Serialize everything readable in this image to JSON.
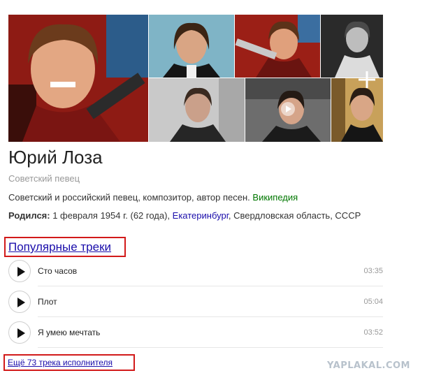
{
  "entity": {
    "name": "Юрий Лоза",
    "subtitle": "Советский певец",
    "description": "Советский и российский певец, композитор, автор песен.",
    "wiki_link": "Википедия",
    "born_label": "Родился:",
    "born_text": " 1 февраля 1954 г. (62 года), ",
    "born_city": "Екатеринбург",
    "born_rest": ", Свердловская область, СССР"
  },
  "gallery": {
    "photos": [
      "portrait-guitar",
      "portrait-studio",
      "portrait-guitar-2",
      "portrait-bw",
      "portrait-interview",
      "portrait-video",
      "portrait-dark"
    ],
    "more_icon": "plus-icon",
    "video_icon": "play-icon"
  },
  "tracks": {
    "heading": "Популярные треки",
    "items": [
      {
        "title": "Сто часов",
        "duration": "03:35"
      },
      {
        "title": "Плот",
        "duration": "05:04"
      },
      {
        "title": "Я умею мечтать",
        "duration": "03:52"
      }
    ],
    "more_link": "Ещё 73 трека исполнителя"
  },
  "watermark": "YAPLAKAL.COM",
  "colors": {
    "link": "#1a0dab",
    "wiki": "#007700",
    "highlight_box": "#d21a1a",
    "muted": "#999999"
  }
}
